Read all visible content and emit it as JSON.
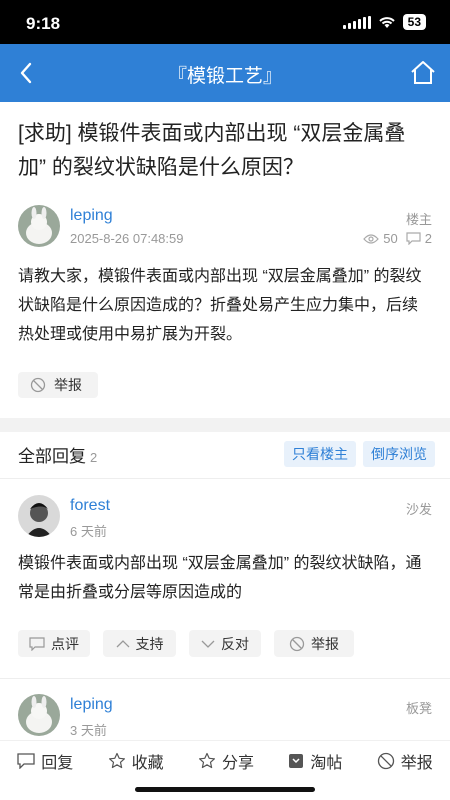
{
  "status": {
    "time": "9:18",
    "battery": "53"
  },
  "nav": {
    "title": "『模锻工艺』",
    "back_icon": "chevron-left-icon",
    "home_icon": "home-icon"
  },
  "post": {
    "title": "[求助] 模锻件表面或内部出现 “双层金属叠加” 的裂纹状缺陷是什么原因？",
    "author": "leping",
    "date": "2025-8-26 07:48:59",
    "floor": "楼主",
    "views": "50",
    "comments": "2",
    "body": "请教大家，模锻件表面或内部出现 “双层金属叠加” 的裂纹状缺陷是什么原因造成的？折叠处易产生应力集中，后续热处理或使用中易扩展为开裂。",
    "report_label": "举报"
  },
  "replies": {
    "header": "全部回复",
    "count": "2",
    "only_op_label": "只看楼主",
    "reverse_label": "倒序浏览",
    "items": [
      {
        "author": "forest",
        "time": "6 天前",
        "floor": "沙发",
        "body": "模锻件表面或内部出现 “双层金属叠加” 的裂纹状缺陷，通常是由折叠或分层等原因造成的",
        "actions": {
          "comment": "点评",
          "support": "支持",
          "oppose": "反对",
          "report": "举报"
        }
      },
      {
        "author": "leping",
        "time": "3 天前",
        "floor": "板凳"
      }
    ]
  },
  "bottom_bar": {
    "reply": "回复",
    "favorite": "收藏",
    "share": "分享",
    "tao": "淘帖",
    "report": "举报"
  },
  "colors": {
    "accent": "#2f80d6",
    "navbar": "#2f80d6",
    "muted": "#999999"
  }
}
